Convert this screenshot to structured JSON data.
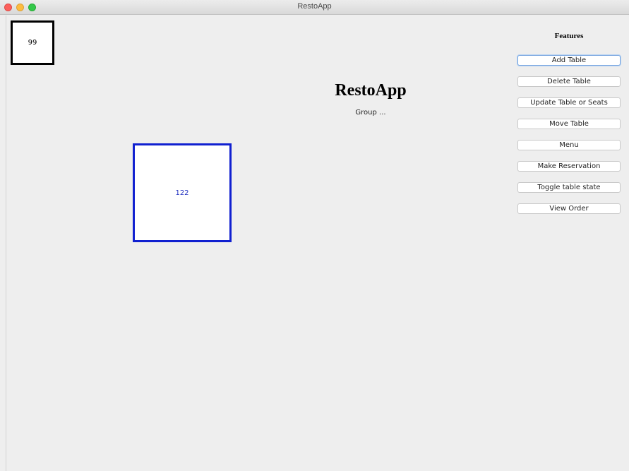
{
  "window": {
    "title": "RestoApp"
  },
  "tables": [
    {
      "number": "99",
      "color": "#000000"
    },
    {
      "number": "122",
      "color": "#1020d0"
    }
  ],
  "header": {
    "title": "RestoApp",
    "subtitle": "Group ..."
  },
  "features": {
    "heading": "Features",
    "buttons": [
      {
        "label": "Add Table",
        "focused": true
      },
      {
        "label": "Delete Table"
      },
      {
        "label": "Update Table or Seats"
      },
      {
        "label": "Move Table"
      },
      {
        "label": "Menu"
      },
      {
        "label": "Make Reservation"
      },
      {
        "label": "Toggle table state"
      },
      {
        "label": "View Order"
      }
    ]
  },
  "icons": {
    "close": "close-icon",
    "minimize": "minimize-icon",
    "maximize": "maximize-icon"
  },
  "colors": {
    "background": "#eeeeee",
    "selected_table_border": "#1020d0"
  }
}
